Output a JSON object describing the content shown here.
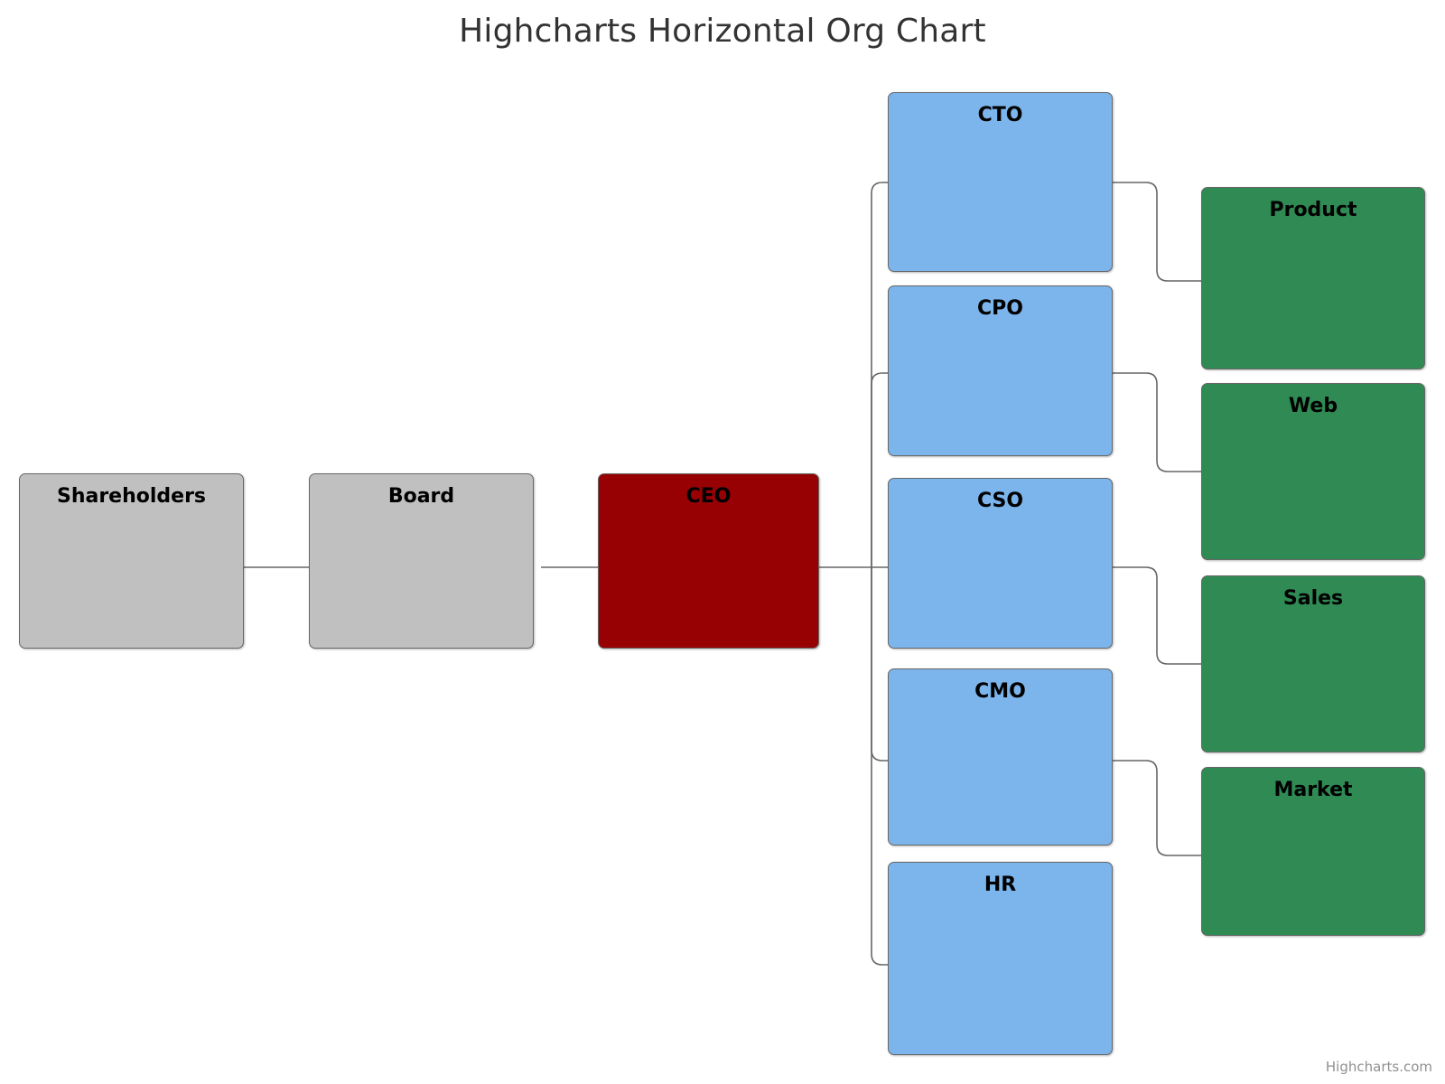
{
  "chart": {
    "title": "Highcharts Horizontal Org Chart",
    "credit": "Highcharts.com",
    "background": "#ffffff",
    "link_color": "#666666"
  },
  "chart_data": {
    "type": "diagram",
    "title": "Highcharts Horizontal Org Chart",
    "orientation": "horizontal",
    "levels": [
      {
        "index": 0,
        "color": "#c0c0c0",
        "nodes": [
          "Shareholders"
        ]
      },
      {
        "index": 1,
        "color": "#c0c0c0",
        "nodes": [
          "Board"
        ]
      },
      {
        "index": 2,
        "color": "#980104",
        "nodes": [
          "CEO"
        ]
      },
      {
        "index": 3,
        "color": "#7cb5ec",
        "nodes": [
          "CTO",
          "CPO",
          "CSO",
          "CMO",
          "HR"
        ]
      },
      {
        "index": 4,
        "color": "#2f8b53",
        "nodes": [
          "Product",
          "Web",
          "Sales",
          "Market"
        ]
      }
    ],
    "links": [
      {
        "from": "Shareholders",
        "to": "Board"
      },
      {
        "from": "Board",
        "to": "CEO"
      },
      {
        "from": "CEO",
        "to": "CTO"
      },
      {
        "from": "CEO",
        "to": "CPO"
      },
      {
        "from": "CEO",
        "to": "CSO"
      },
      {
        "from": "CEO",
        "to": "CMO"
      },
      {
        "from": "CEO",
        "to": "HR"
      },
      {
        "from": "CTO",
        "to": "Product"
      },
      {
        "from": "CPO",
        "to": "Web"
      },
      {
        "from": "CSO",
        "to": "Sales"
      },
      {
        "from": "CMO",
        "to": "Market"
      }
    ]
  },
  "nodes": {
    "shareholders": {
      "label": "Shareholders",
      "color": "#c0c0c0"
    },
    "board": {
      "label": "Board",
      "color": "#c0c0c0"
    },
    "ceo": {
      "label": "CEO",
      "color": "#980104"
    },
    "cto": {
      "label": "CTO",
      "color": "#7cb5ec"
    },
    "cpo": {
      "label": "CPO",
      "color": "#7cb5ec"
    },
    "cso": {
      "label": "CSO",
      "color": "#7cb5ec"
    },
    "cmo": {
      "label": "CMO",
      "color": "#7cb5ec"
    },
    "hr": {
      "label": "HR",
      "color": "#7cb5ec"
    },
    "product": {
      "label": "Product",
      "color": "#2f8b53"
    },
    "web": {
      "label": "Web",
      "color": "#2f8b53"
    },
    "sales": {
      "label": "Sales",
      "color": "#2f8b53"
    },
    "market": {
      "label": "Market",
      "color": "#2f8b53"
    }
  }
}
